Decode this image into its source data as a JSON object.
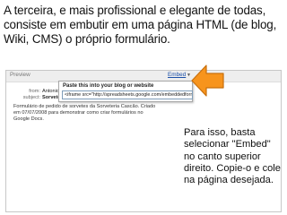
{
  "heading": "A terceira, e mais profissional e elegante de todas, consiste em embutir em uma página HTML (de blog, Wiki, CMS) o próprio formulário.",
  "panel": {
    "preview_label": "Preview",
    "embed_link": "Embed",
    "from_label": "from:",
    "from_value": "Antonio",
    "subject_label": "subject:",
    "subject_value": "Sorvete",
    "popup_title": "Paste this into your blog or website",
    "embed_code": "<iframe src=\"http://spreadsheets.google.com/embeddedform?k",
    "form_description": "Formulário de pedido de sorvetes da Sorveteria Cascão. Criado em 07/07/2008 para demonstrar como criar formulários no Google Docs."
  },
  "side_text": "Para isso, basta selecionar \"Embed\" no canto superior direito. Copie-o e cole na página desejada.",
  "colors": {
    "arrow_fill": "#f7941d",
    "arrow_stroke": "#c86f0c",
    "link": "#1b4fa8"
  },
  "icons": {
    "dropdown": "chevron-down-icon",
    "pointer": "orange-arrow-left"
  }
}
